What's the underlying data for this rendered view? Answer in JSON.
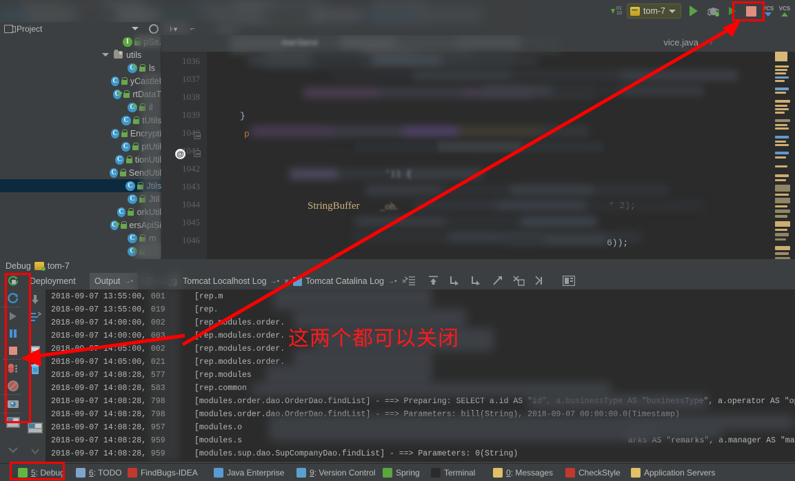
{
  "window": {
    "title_blurred": true
  },
  "toolbar": {
    "run_config_label": "tom-7",
    "icons": [
      {
        "name": "updown-counter-icon"
      },
      {
        "name": "run-config-selector",
        "label": "tom-7"
      },
      {
        "name": "run-icon"
      },
      {
        "name": "debug-icon"
      },
      {
        "name": "run-with-coverage-icon"
      },
      {
        "name": "stop-icon"
      },
      {
        "name": "vcs-update-icon",
        "label": "VCS"
      },
      {
        "name": "vcs-commit-icon",
        "label": "VCS"
      }
    ]
  },
  "project_panel": {
    "title": "Project",
    "tree": [
      {
        "label": "pSe.",
        "icon": "interface-icon",
        "indent": 196,
        "blurred": true
      },
      {
        "label": "utils",
        "icon": "folder-icon",
        "indent": 170,
        "expanded": true
      },
      {
        "label": "ls",
        "icon": "class-runnable-icon",
        "indent": 196
      },
      {
        "label": "yCastleI",
        "icon": "class-icon",
        "indent": 196
      },
      {
        "label": "rtDataT",
        "icon": "class-runnable-icon",
        "indent": 196
      },
      {
        "label": "il",
        "icon": "class-runnable-icon",
        "indent": 196
      },
      {
        "label": "tUtils",
        "icon": "class-icon",
        "indent": 196
      },
      {
        "label": "Encrypti",
        "icon": "class-icon",
        "indent": 196
      },
      {
        "label": "ptUtil",
        "icon": "class-icon",
        "indent": 196
      },
      {
        "label": "tionUtil",
        "icon": "class-icon",
        "indent": 196
      },
      {
        "label": "SendUtil",
        "icon": "class-icon",
        "indent": 196
      },
      {
        "label": "Jtils",
        "icon": "class-icon",
        "indent": 196,
        "selected": true
      },
      {
        "label": "Jtil",
        "icon": "class-icon",
        "indent": 196
      },
      {
        "label": "orkUtil",
        "icon": "class-icon",
        "indent": 196
      },
      {
        "label": "ersApiSi",
        "icon": "class-runnable-icon",
        "indent": 196
      },
      {
        "label": "m",
        "icon": "class-icon",
        "indent": 196
      },
      {
        "label": "",
        "icon": "class-runnable-icon",
        "indent": 196
      }
    ]
  },
  "editor": {
    "tab_label_partial": "vice.java",
    "tab_hidden_label": "merServi",
    "line_numbers": [
      "1036",
      "1037",
      "1038",
      "1039",
      "1040",
      "1041",
      "1042",
      "1043",
      "1044",
      "1045",
      "1046"
    ],
    "code_fragments": [
      {
        "text": "}",
        "line": 1039
      },
      {
        "text": "p",
        "line": 1040
      },
      {
        "text": "StringBuffer",
        "line": 1041
      },
      {
        "text": "* 2);",
        "line": 1041
      },
      {
        "text": "6));",
        "line": 1046
      }
    ],
    "annotation_marker": "@"
  },
  "debug_panel": {
    "header_label": "Debug",
    "header_config": "tom-7",
    "tabs": [
      {
        "label": "Deployment",
        "active": false
      },
      {
        "label": "Output",
        "active": true,
        "pin": "→•"
      },
      {
        "label": "Debugg",
        "active": false
      },
      {
        "label": "Tomcat Localhost Log",
        "active": false,
        "pin": "→•",
        "closable": true
      },
      {
        "label": "Tomcat Catalina Log",
        "active": false,
        "pin": "→•",
        "closable": true
      }
    ],
    "left_toolbar_icons": [
      "rerun-icon",
      "restart-icon",
      "resume-program-icon",
      "pause-program-icon",
      "stop-icon",
      "view-breakpoints-icon",
      "mute-breakpoints-icon",
      "settings-icon",
      "layout-icon"
    ],
    "second_toolbar_icons": [
      "scroll-up-icon",
      "scroll-down-icon",
      "thread-dump-icon",
      "print-icon",
      "clear-all-icon"
    ],
    "console_toolbar_icons": [
      "soft-wrap-icon",
      "scroll-to-end-icon",
      "scroll-down-icon",
      "scroll-down-2-icon",
      "scroll-up-right-icon",
      "clear-all-icon",
      "cut-icon",
      "print-icon"
    ]
  },
  "log": {
    "lines": [
      {
        "ts": "2018-09-07 13:55:00, 001",
        "msg": "[rep.m"
      },
      {
        "ts": "2018-09-07 13:55:00, 019",
        "msg": "[rep."
      },
      {
        "ts": "2018-09-07 14:00:00, 002",
        "msg": "[rep.modules.order."
      },
      {
        "ts": "2018-09-07 14:00:00, 003",
        "msg": "[rep.modules.order."
      },
      {
        "ts": "2018-09-07 14:05:00, 002",
        "msg": "[rep.modules.order."
      },
      {
        "ts": "2018-09-07 14:05:00, 021",
        "msg": "[rep.modules.order."
      },
      {
        "ts": "2018-09-07 14:08:28, 577",
        "msg": "[rep.modules"
      },
      {
        "ts": "2018-09-07 14:08:28, 583",
        "msg": "[rep.common"
      },
      {
        "ts": "2018-09-07 14:08:28, 798",
        "msg": "[modules.order.dao.OrderDao.findList] - ==>  Preparing: SELECT a.id AS \"id\",  a.businessType AS \"businessType\", a.operator AS \"operator\", a"
      },
      {
        "ts": "2018-09-07 14:08:28, 798",
        "msg": "[modules.order.dao.OrderDao.findList] - ==> Parameters: bill(String), 2018-09-07 00:00:00.0(Timestamp)"
      },
      {
        "ts": "2018-09-07 14:08:28, 957",
        "msg": "[modules.o"
      },
      {
        "ts": "2018-09-07 14:08:28, 959",
        "msg": "[modules.s",
        "tail": "arks AS \"remarks\", a.manager AS \"ma"
      },
      {
        "ts": "2018-09-07 14:08:28, 959",
        "msg": "[modules.sup.dao.SupCompanyDao.findList] - ==> Parameters: 0(String)"
      }
    ]
  },
  "statusbar": {
    "items": [
      {
        "label": "5: Debug",
        "num": "5",
        "rest": ": Debug",
        "icon": "debug-icon",
        "highlighted": true
      },
      {
        "label": "6: TODO",
        "num": "6",
        "rest": ": TODO",
        "icon": "todo-icon"
      },
      {
        "label": "FindBugs-IDEA",
        "num": "",
        "rest": "FindBugs-IDEA",
        "icon": "findbugs-icon"
      },
      {
        "label": "Java Enterprise",
        "num": "",
        "rest": "Java Enterprise",
        "icon": "java-enterprise-icon"
      },
      {
        "label": "9: Version Control",
        "num": "9",
        "rest": ": Version Control",
        "icon": "version-control-icon"
      },
      {
        "label": "Spring",
        "num": "",
        "rest": "Spring",
        "icon": "spring-icon"
      },
      {
        "label": "Terminal",
        "num": "",
        "rest": "Terminal",
        "icon": "terminal-icon"
      },
      {
        "label": "0: Messages",
        "num": "0",
        "rest": ": Messages",
        "icon": "messages-icon"
      },
      {
        "label": "CheckStyle",
        "num": "",
        "rest": "CheckStyle",
        "icon": "checkstyle-icon"
      },
      {
        "label": "Application Servers",
        "num": "",
        "rest": "Application Servers",
        "icon": "application-servers-icon"
      }
    ]
  },
  "annotations": {
    "note_text": "这两个都可以关闭",
    "color": "#ff0000",
    "boxes": [
      {
        "name": "stop-button-highlight"
      },
      {
        "name": "debug-toolbar-highlight"
      },
      {
        "name": "status-debug-highlight"
      }
    ],
    "arrows": [
      {
        "name": "arrow-to-stop-button"
      },
      {
        "name": "arrow-to-debug-toolbar"
      }
    ]
  }
}
